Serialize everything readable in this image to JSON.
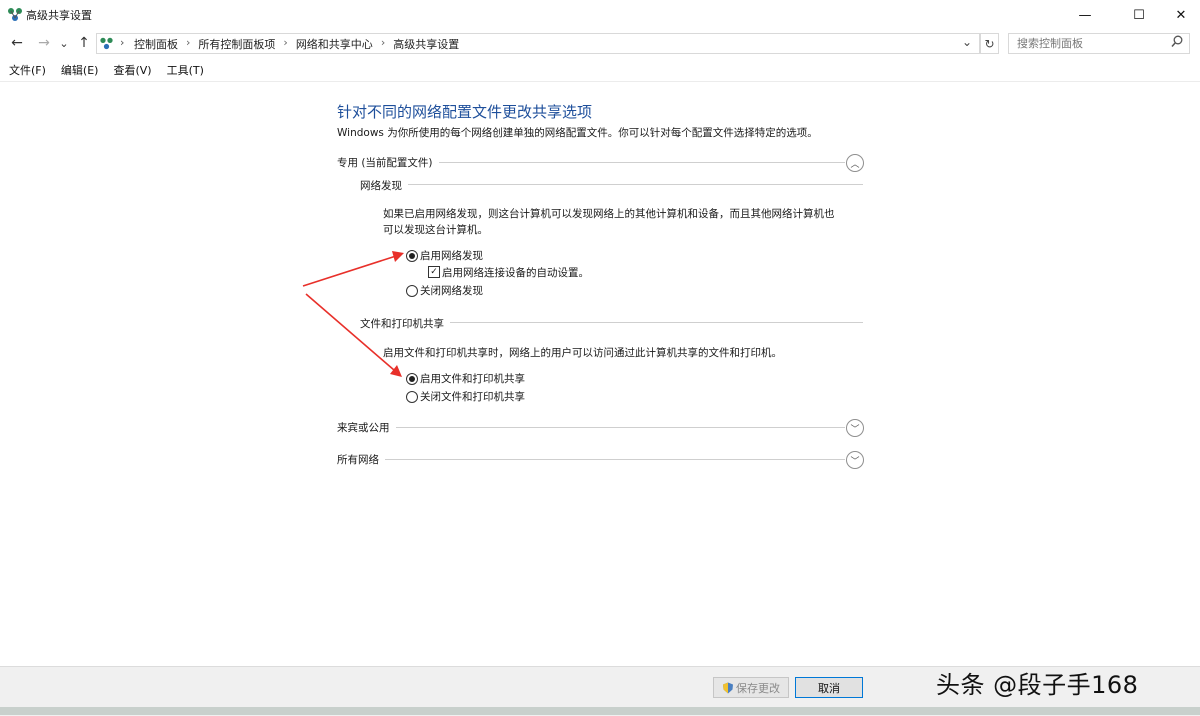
{
  "window": {
    "title": "高级共享设置",
    "minimize": "—",
    "maximize": "☐",
    "close": "✕"
  },
  "nav": {
    "back": "←",
    "forward": "→",
    "recent": "⌄",
    "up": "↑"
  },
  "address": {
    "crumbs": [
      "控制面板",
      "所有控制面板项",
      "网络和共享中心",
      "高级共享设置"
    ],
    "separator": "›",
    "dropdown": "⌄",
    "refresh": "↻"
  },
  "search": {
    "placeholder": "搜索控制面板",
    "icon": "search-icon"
  },
  "menu": [
    "文件(F)",
    "编辑(E)",
    "查看(V)",
    "工具(T)"
  ],
  "main": {
    "heading": "针对不同的网络配置文件更改共享选项",
    "description": "Windows 为你所使用的每个网络创建单独的网络配置文件。你可以针对每个配置文件选择特定的选项。",
    "profiles": [
      {
        "label": "专用 (当前配置文件)",
        "expanded": true
      },
      {
        "label": "来宾或公用",
        "expanded": false
      },
      {
        "label": "所有网络",
        "expanded": false
      }
    ],
    "discovery": {
      "title": "网络发现",
      "description_line1": "如果已启用网络发现，则这台计算机可以发现网络上的其他计算机和设备，而且其他网络计算机也",
      "description_line2": "可以发现这台计算机。",
      "on_label": "启用网络发现",
      "auto_label": "启用网络连接设备的自动设置。",
      "off_label": "关闭网络发现"
    },
    "sharing": {
      "title": "文件和打印机共享",
      "description": "启用文件和打印机共享时，网络上的用户可以访问通过此计算机共享的文件和打印机。",
      "on_label": "启用文件和打印机共享",
      "off_label": "关闭文件和打印机共享"
    }
  },
  "footer": {
    "save_label": "保存更改",
    "cancel_label": "取消"
  },
  "watermark": "头条 @段子手168",
  "colors": {
    "heading": "#1e4f9b",
    "annotation_arrow": "#e8302a",
    "primary_border": "#0078d7"
  }
}
